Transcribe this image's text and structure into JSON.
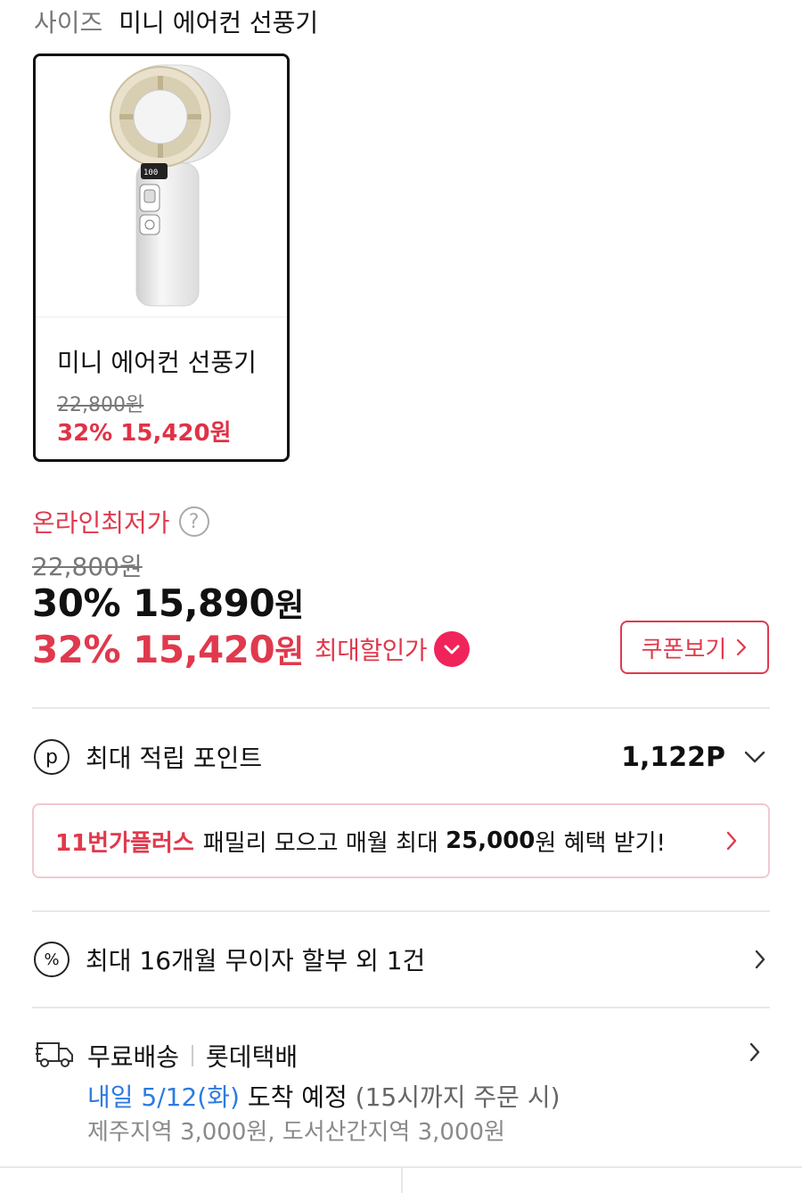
{
  "size_selector": {
    "label": "사이즈",
    "value": "미니 에어컨 선풍기"
  },
  "product_card": {
    "name": "미니 에어컨 선풍기",
    "original_price": "22,800원",
    "sale_price": "32% 15,420원",
    "image_icon": "handheld-fan-image"
  },
  "pricing": {
    "lowest_label": "온라인최저가",
    "help_icon": "question-circle-icon",
    "original_price": "22,800원",
    "price1_main": "30% 15,890",
    "price1_unit": "원",
    "price2_main": "32% 15,420",
    "price2_unit": "원",
    "max_discount_label": "최대할인가",
    "coupon_button_label": "쿠폰보기"
  },
  "points": {
    "label": "최대 적립 포인트",
    "value": "1,122P",
    "icon": "p-circle-icon"
  },
  "plus_banner": {
    "brand": "11번가플러스",
    "text_before": "패밀리 모으고 매월 최대",
    "amount": "25,000",
    "text_after": "원 혜택 받기!"
  },
  "installment": {
    "label": "최대 16개월 무이자 할부 외 1건",
    "icon": "percent-circle-icon"
  },
  "shipping": {
    "free_label": "무료배송",
    "carrier": "롯데택배",
    "date": "내일 5/12(화)",
    "arrival": "도착 예정",
    "note": "(15시까지 주문 시)",
    "extra": "제주지역 3,000원, 도서산간지역 3,000원",
    "icon": "truck-icon"
  },
  "colors": {
    "accent": "#e0394d",
    "blue": "#2d7be0",
    "gray": "#777777"
  }
}
